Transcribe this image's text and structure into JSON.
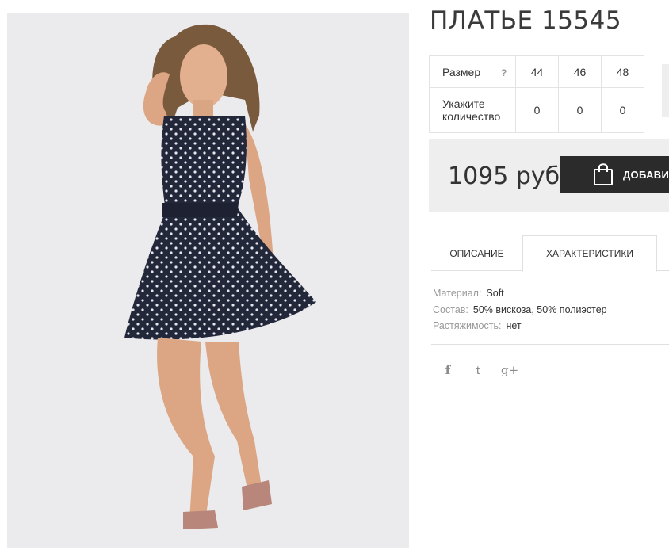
{
  "product": {
    "title": "ПЛАТЬЕ 15545",
    "photo_alt": "product-photo"
  },
  "sizes": {
    "size_label": "Размер",
    "help": "?",
    "qty_label": "Укажите количество",
    "values": [
      "44",
      "46",
      "48"
    ],
    "quantities": [
      "0",
      "0",
      "0"
    ]
  },
  "price": {
    "amount": "1095 руб",
    "add_button": "ДОБАВИТ"
  },
  "tabs": {
    "description": "ОПИСАНИЕ",
    "characteristics": "ХАРАКТЕРИСТИКИ"
  },
  "specs": [
    {
      "key": "Материал:",
      "value": "Soft"
    },
    {
      "key": "Состав:",
      "value": "50% вискоза, 50% полиэстер"
    },
    {
      "key": "Растяжимость:",
      "value": "нет"
    }
  ],
  "social": {
    "facebook": "f",
    "twitter": "t",
    "google": "g+"
  },
  "colors": {
    "dress": "#23273a",
    "button": "#2b2b2b",
    "panel": "#eeeeee"
  }
}
